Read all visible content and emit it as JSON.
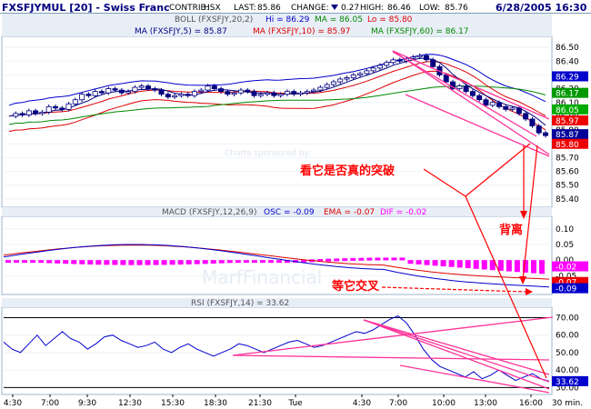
{
  "header": {
    "symbol": "FXSFJYMUL [20] - Swiss Franc",
    "contrib_label": "CONTRIB:",
    "contrib": "HSX",
    "last_label": "LAST:",
    "last": "85.86",
    "change_label": "CHANGE:",
    "change": "0.27",
    "high_label": "HIGH:",
    "high": "86.46",
    "low_label": "LOW:",
    "low": "85.76",
    "datetime": "6/28/2005 16:30"
  },
  "legends": {
    "boll": "BOLL (FXSFJY,20,2)",
    "boll_hi": "Hi = 86.29",
    "boll_ma": "MA = 86.05",
    "boll_lo": "Lo = 85.80",
    "ma5": "MA (FXSFJY,5) = 85.87",
    "ma10": "MA (FXSFJY,10) = 85.97",
    "ma60": "MA (FXSFJY,60) = 86.17",
    "macd": "MACD (FXSFJY,12,26,9)",
    "osc": "OSC = -0.09",
    "ema": "EMA = -0.07",
    "dif": "DIF = -0.02",
    "rsi": "RSI (FXSFJY,14) = 33.62"
  },
  "watermark": {
    "sponsored": "Charts sponsored by:",
    "brand": "MarfFinancial"
  },
  "annotations": {
    "breakout": "看它是否真的突破",
    "divergence": "背离",
    "wait_cross": "等它交叉"
  },
  "x_ticks": [
    "4:30",
    "7:00",
    "9:30",
    "12:30",
    "15:30",
    "18:30",
    "21:30",
    "Tue",
    "4:30",
    "7:00",
    "10:00",
    "13:00",
    "16:00",
    "30 min."
  ],
  "colors": {
    "up_candle": "#ffffff",
    "down_candle": "#000080",
    "boll": "#0000cc",
    "ma5": "#000080",
    "ma10": "#dd0000",
    "ma60": "#008800",
    "macd_hist": "#ff00ff",
    "annotation": "#ff0000",
    "trendline": "#ff3399"
  },
  "chart_data": [
    {
      "type": "candlestick",
      "y_ticks": [
        "86.50",
        "86.40",
        "86.30",
        "86.20",
        "86.10",
        "86.00",
        "85.90",
        "85.80",
        "85.70",
        "85.60",
        "85.50",
        "85.40"
      ],
      "ylim": [
        85.34,
        86.58
      ],
      "tags": [
        {
          "label": "86.29",
          "value": 86.29,
          "color": "#0000cc"
        },
        {
          "label": "86.17",
          "value": 86.17,
          "color": "#009900"
        },
        {
          "label": "86.05",
          "value": 86.05,
          "color": "#00aa00"
        },
        {
          "label": "85.97",
          "value": 85.97,
          "color": "#ee0000"
        },
        {
          "label": "85.87",
          "value": 85.87,
          "color": "#000099"
        },
        {
          "label": "85.80",
          "value": 85.8,
          "color": "#ee0000"
        }
      ],
      "close_path": [
        86.0,
        86.02,
        86.01,
        86.04,
        86.02,
        86.03,
        86.07,
        86.06,
        86.05,
        86.09,
        86.12,
        86.16,
        86.15,
        86.18,
        86.17,
        86.2,
        86.19,
        86.17,
        86.18,
        86.21,
        86.22,
        86.2,
        86.19,
        86.16,
        86.14,
        86.15,
        86.16,
        86.15,
        86.18,
        86.19,
        86.22,
        86.2,
        86.18,
        86.16,
        86.17,
        86.19,
        86.18,
        86.15,
        86.16,
        86.17,
        86.15,
        86.16,
        86.18,
        86.16,
        86.17,
        86.18,
        86.19,
        86.21,
        86.23,
        86.25,
        86.27,
        86.28,
        86.3,
        86.31,
        86.33,
        86.35,
        86.37,
        86.39,
        86.41,
        86.4,
        86.42,
        86.43,
        86.44,
        86.41,
        86.36,
        86.3,
        86.25,
        86.2,
        86.22,
        86.18,
        86.15,
        86.12,
        86.08,
        86.1,
        86.07,
        86.05,
        86.06,
        86.02,
        85.98,
        85.93,
        85.88,
        85.86
      ]
    },
    {
      "type": "line",
      "name": "MACD",
      "y_ticks": [
        "0.10",
        "0.05",
        "0.00",
        "-0.05"
      ],
      "ylim": [
        -0.11,
        0.14
      ],
      "tags": [
        {
          "label": "-0.02",
          "value": -0.02,
          "color": "#ff00ff"
        },
        {
          "label": "-0.07",
          "value": -0.07,
          "color": "#ee0000"
        },
        {
          "label": "-0.09",
          "value": -0.09,
          "color": "#0000cc"
        }
      ]
    },
    {
      "type": "line",
      "name": "RSI",
      "y_ticks": [
        "70.00",
        "60.00",
        "50.00",
        "40.00",
        "30.00"
      ],
      "ylim": [
        26,
        76
      ],
      "tags": [
        {
          "label": "33.62",
          "value": 33.62,
          "color": "#0000cc"
        }
      ],
      "values": [
        56,
        52,
        50,
        55,
        60,
        54,
        58,
        62,
        58,
        56,
        52,
        55,
        59,
        60,
        57,
        55,
        53,
        54,
        56,
        52,
        50,
        53,
        55,
        52,
        50,
        48,
        50,
        52,
        55,
        54,
        52,
        50,
        52,
        54,
        56,
        57,
        55,
        53,
        54,
        56,
        58,
        60,
        62,
        61,
        63,
        66,
        69,
        71,
        67,
        60,
        52,
        46,
        42,
        40,
        38,
        36,
        39,
        35,
        37,
        40,
        37,
        34,
        36,
        38,
        35,
        33.62
      ]
    }
  ]
}
